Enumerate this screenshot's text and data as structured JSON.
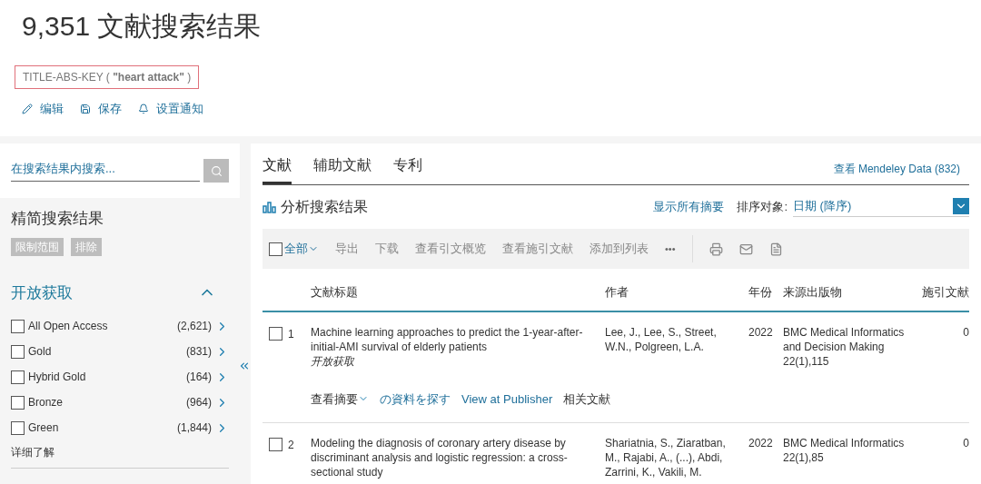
{
  "header": {
    "title": "9,351 文献搜索结果",
    "query": "TITLE-ABS-KEY ( **\"heart attack\"** )",
    "actions": [
      {
        "kind": "edit",
        "label": "编辑"
      },
      {
        "kind": "save",
        "label": "保存"
      },
      {
        "kind": "alert",
        "label": "设置通知"
      }
    ]
  },
  "sidebar": {
    "search": {
      "placeholder": "在搜索结果内搜索..."
    },
    "refine_title": "精简搜索结果",
    "refine_buttons": [
      "限制范围",
      "排除"
    ],
    "facet": {
      "title": "开放获取",
      "expanded": true,
      "items": [
        {
          "label": "All Open Access",
          "count": "(2,621)",
          "checked": false
        },
        {
          "label": "Gold",
          "count": "(831)",
          "checked": false
        },
        {
          "label": "Hybrid Gold",
          "count": "(164)",
          "checked": false
        },
        {
          "label": "Bronze",
          "count": "(964)",
          "checked": false
        },
        {
          "label": "Green",
          "count": "(1,844)",
          "checked": false
        }
      ],
      "more": "详细了解"
    }
  },
  "tabs": [
    {
      "label": "文献",
      "selected": true
    },
    {
      "label": "辅助文献",
      "selected": false
    },
    {
      "label": "专利",
      "selected": false
    }
  ],
  "mendeley_link": "查看 Mendeley Data (832)",
  "analyze": "分析搜索结果",
  "show_abstracts": "显示所有摘要",
  "sort": {
    "label": "排序对象:",
    "value": "日期 (降序)"
  },
  "toolbar": {
    "select_all": {
      "label": "全部",
      "checked": false
    },
    "items": [
      "导出",
      "下载",
      "查看引文概览",
      "查看施引文献",
      "添加到列表"
    ],
    "more": "•••"
  },
  "table": {
    "columns": [
      "文献标题",
      "作者",
      "年份",
      "来源出版物",
      "施引文献"
    ],
    "rows": [
      {
        "number": "1",
        "checked": false,
        "title": "Machine learning approaches to predict the 1-year-after-initial-AMI survival of elderly patients",
        "open_access": "开放获取",
        "authors": "Lee, J., Lee, S., Street, W.N., Polgreen, L.A.",
        "year": "2022",
        "source": [
          "BMC Medical Informatics and Decision Making",
          "22(1),115"
        ],
        "cited": "0",
        "links": [
          {
            "label": "查看摘要",
            "kind": "toggle"
          },
          {
            "label": "の資料を探す",
            "kind": "link"
          },
          {
            "label": "View at Publisher",
            "kind": "link"
          },
          {
            "label": "相关文献",
            "kind": "plain"
          }
        ]
      },
      {
        "number": "2",
        "checked": false,
        "title": "Modeling the diagnosis of coronary artery disease by discriminant analysis and logistic regression: a cross-sectional study",
        "authors": "Shariatnia, S., Ziaratban, M., Rajabi, A., (...), Abdi, Zarrini, K., Vakili, M.",
        "year": "2022",
        "source": [
          "BMC Medical Informatics",
          "22(1),85"
        ],
        "cited": "0",
        "links": []
      }
    ]
  }
}
